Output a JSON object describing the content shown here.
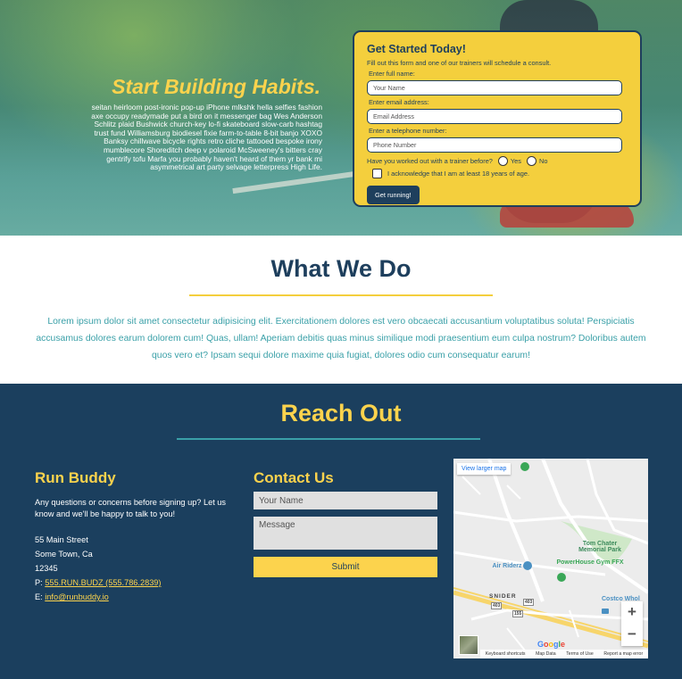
{
  "hero": {
    "heading": "Start Building Habits.",
    "text": "seitan heirloom post-ironic pop-up iPhone mlkshk hella selfies fashion axe occupy readymade put a bird on it messenger bag Wes Anderson Schlitz plaid Bushwick church-key lo-fi skateboard slow-carb hashtag trust fund Williamsburg biodiesel fixie farm-to-table 8-bit banjo XOXO Banksy chillwave bicycle rights retro cliche tattooed bespoke irony mumblecore Shoreditch deep v polaroid McSweeney's bitters cray gentrify tofu Marfa you probably haven't heard of them yr bank mi asymmetrical art party selvage letterpress High Life."
  },
  "form": {
    "title": "Get Started Today!",
    "subtitle": "Fill out this form and one of our trainers will schedule a consult.",
    "name_label": "Enter full name:",
    "name_placeholder": "Your Name",
    "email_label": "Enter email address:",
    "email_placeholder": "Email Address",
    "phone_label": "Enter a telephone number:",
    "phone_placeholder": "Phone Number",
    "trainer_question": "Have you worked out with a trainer before?",
    "yes_label": "Yes",
    "no_label": "No",
    "age_ack": "I acknowledge that I am at least 18 years of age.",
    "submit_label": "Get running!"
  },
  "what_we_do": {
    "title": "What We Do",
    "text": "Lorem ipsum dolor sit amet consectetur adipisicing elit. Exercitationem dolores est vero obcaecati accusantium voluptatibus soluta! Perspiciatis accusamus dolores earum dolorem cum! Quas, ullam! Aperiam debitis quas minus similique modi praesentium eum culpa nostrum? Doloribus autem quos vero et? Ipsam sequi dolore maxime quia fugiat, dolores odio cum consequatur earum!"
  },
  "reach_out": {
    "title": "Reach Out",
    "run_buddy": {
      "title": "Run Buddy",
      "text": "Any questions or concerns before signing up? Let us know and we'll be happy to talk to you!",
      "street": "55 Main Street",
      "city": "Some Town, Ca",
      "zip": "12345",
      "phone_prefix": "P:",
      "phone": "555.RUN.BUDZ (555.786.2839)",
      "email_prefix": "E:",
      "email": "info@runbuddy.io"
    },
    "contact": {
      "title": "Contact Us",
      "name_placeholder": "Your Name",
      "message_placeholder": "Message",
      "submit_label": "Submit"
    },
    "map": {
      "larger_map": "View larger map",
      "park_label": "Tom Chater Memorial Park",
      "gym_label": "PowerHouse Gym FFX",
      "air_label": "Air Riderz",
      "costco_label": "Costco Whol",
      "snider_label": "SNIDER",
      "road_403a": "403",
      "road_403b": "403",
      "road_155": "155",
      "zoom_in": "+",
      "zoom_out": "−",
      "google": "Google",
      "footer": [
        "Keyboard shortcuts",
        "Map Data",
        "Terms of Use",
        "Report a map error"
      ]
    }
  },
  "colors": {
    "navy": "#1e3f5d",
    "yellow": "#fcd34d",
    "teal": "#3aa0a8"
  }
}
